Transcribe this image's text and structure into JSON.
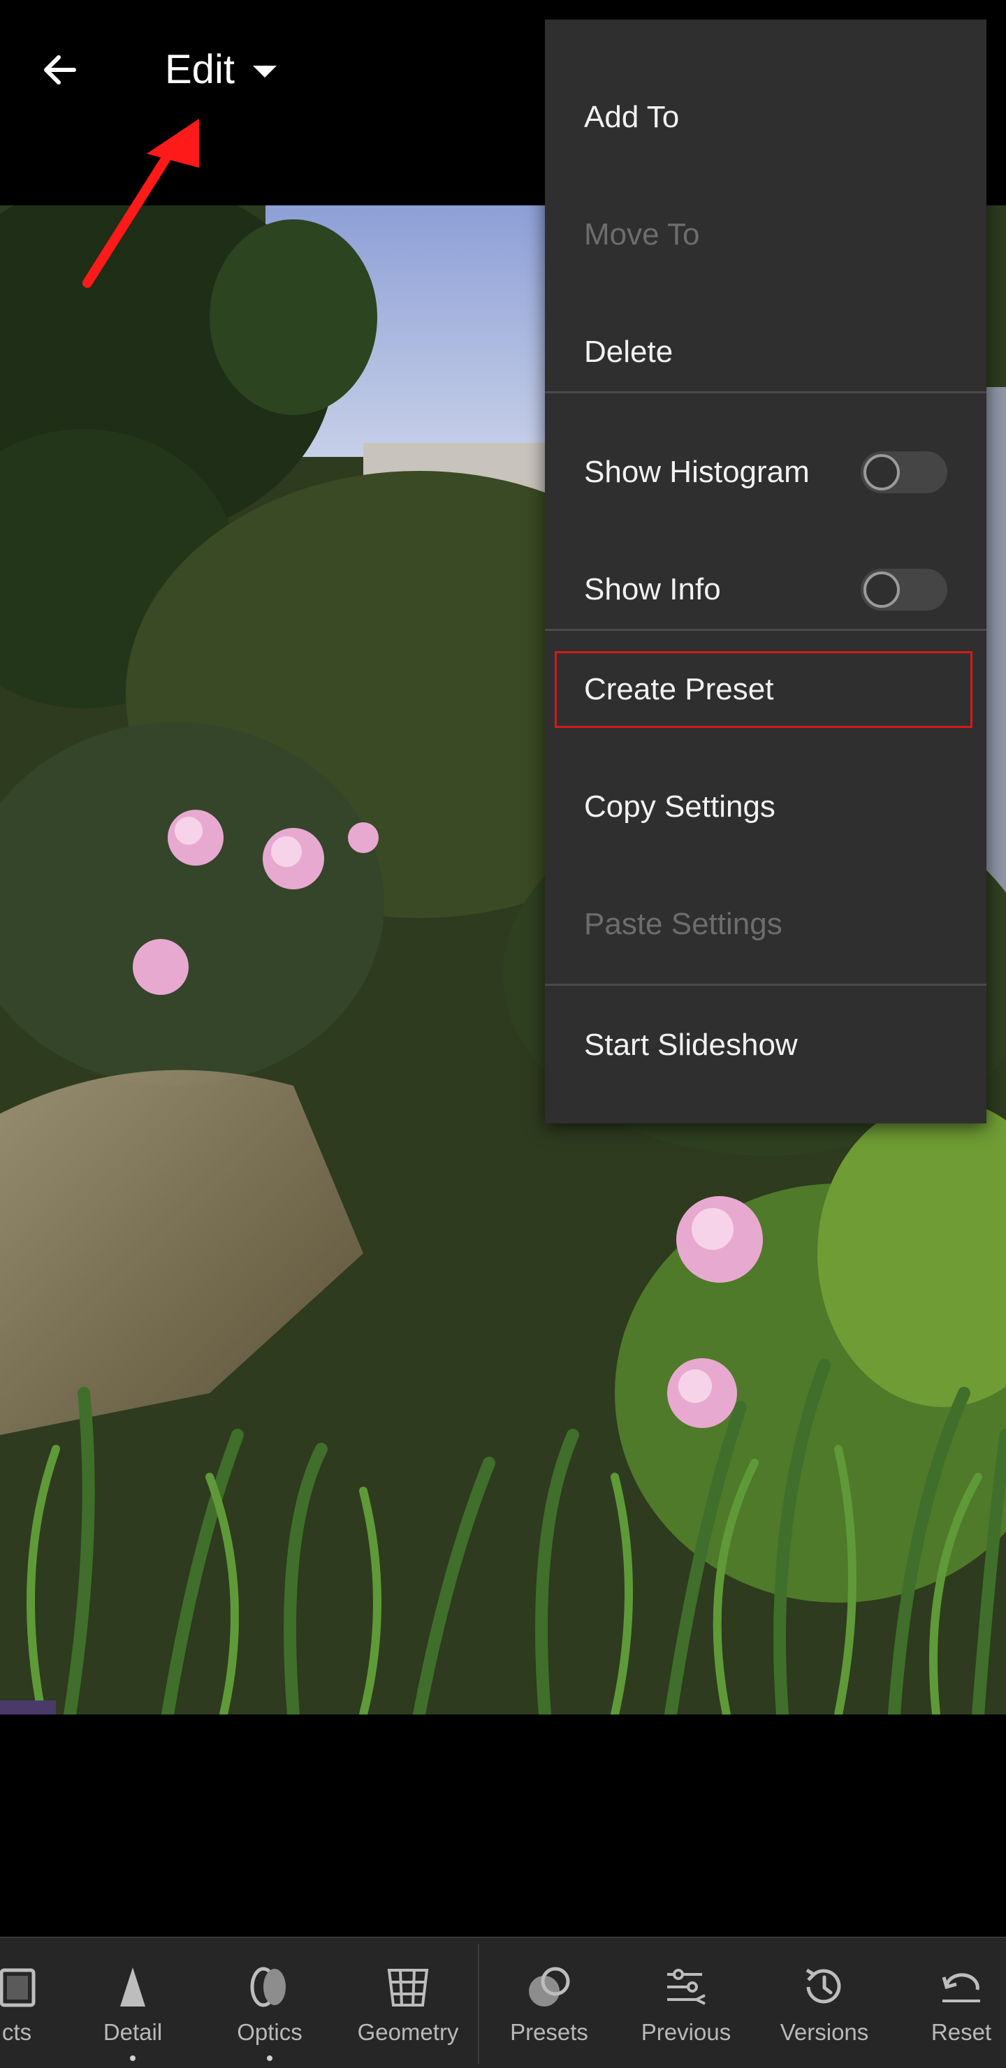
{
  "header": {
    "back_icon": "arrow-left-icon",
    "mode_label": "Edit",
    "mode_caret_icon": "caret-down-icon"
  },
  "menu": {
    "items": [
      {
        "label": "Add To",
        "enabled": true
      },
      {
        "label": "Move To",
        "enabled": false
      },
      {
        "label": "Delete",
        "enabled": true
      },
      {
        "label": "Show Histogram",
        "enabled": true,
        "toggle": false
      },
      {
        "label": "Show Info",
        "enabled": true,
        "toggle": false
      },
      {
        "label": "Create Preset",
        "enabled": true,
        "highlighted": true
      },
      {
        "label": "Copy Settings",
        "enabled": true
      },
      {
        "label": "Paste Settings",
        "enabled": false
      },
      {
        "label": "Start Slideshow",
        "enabled": true
      }
    ]
  },
  "annotation": {
    "color": "#ff1a1a",
    "highlight_color": "#d41a1a"
  },
  "toolbar": {
    "items": [
      {
        "label": "cts",
        "icon": "effects-icon"
      },
      {
        "label": "Detail",
        "icon": "detail-icon"
      },
      {
        "label": "Optics",
        "icon": "optics-icon"
      },
      {
        "label": "Geometry",
        "icon": "geometry-icon"
      },
      {
        "label": "Presets",
        "icon": "presets-icon"
      },
      {
        "label": "Previous",
        "icon": "previous-icon"
      },
      {
        "label": "Versions",
        "icon": "versions-icon"
      },
      {
        "label": "Reset",
        "icon": "reset-icon"
      }
    ]
  },
  "colors": {
    "menu_bg": "#2f2f2f",
    "toolbar_bg": "#262626",
    "text": "#f2f2f2",
    "disabled_text": "#6d6d6d"
  }
}
